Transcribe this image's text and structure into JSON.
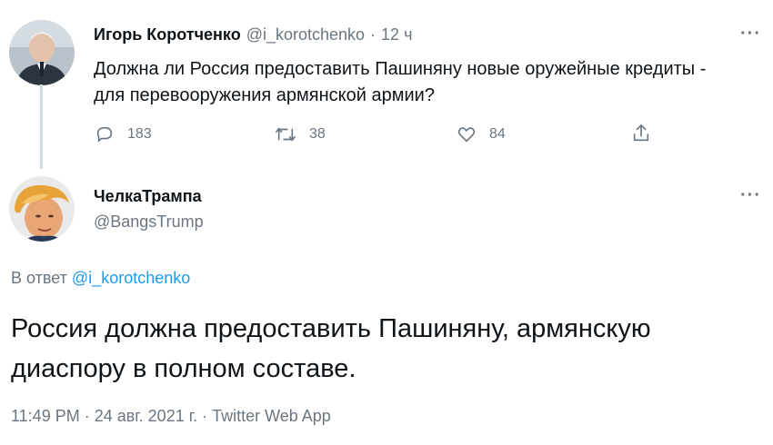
{
  "parent_tweet": {
    "author_name": "Игорь Коротченко",
    "author_handle": "@i_korotchenko",
    "separator": "·",
    "time": "12 ч",
    "text_line1": "Должна ли Россия предоставить Пашиняну новые оружейные кредиты -",
    "text_line2": "для перевооружения армянской армии?",
    "reply_count": "183",
    "retweet_count": "38",
    "like_count": "84",
    "more_label": "···"
  },
  "main_tweet": {
    "author_name": "ЧелкаТрампа",
    "author_handle": "@BangsTrump",
    "more_label": "···",
    "reply_prefix": "В ответ",
    "reply_mention": "@i_korotchenko",
    "text_line1": "Россия должна предоставить Пашиняну, армянскую",
    "text_line2": "диаспору в полном составе.",
    "timestamp": "11:49 PM · 24 авг. 2021 г. · Twitter Web App"
  },
  "colors": {
    "accent": "#1d9bf0",
    "muted": "#6a7681",
    "text": "#0f1419"
  },
  "icons": [
    "reply-icon",
    "retweet-icon",
    "like-icon",
    "share-icon",
    "more-icon"
  ]
}
